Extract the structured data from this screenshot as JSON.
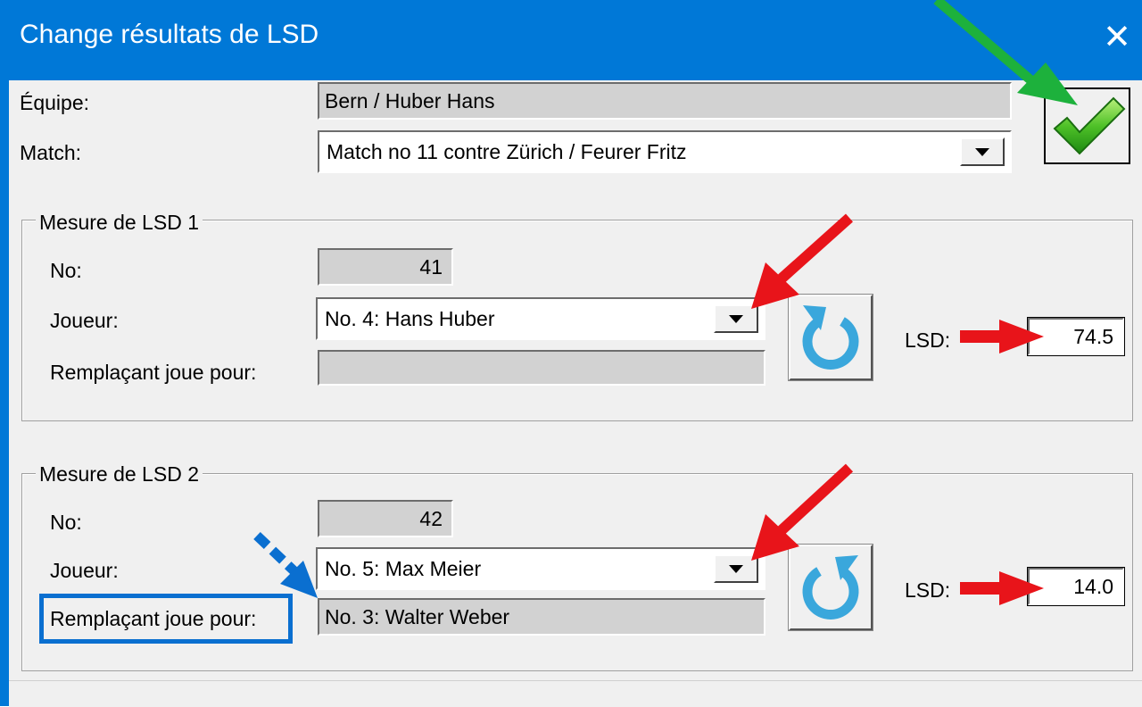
{
  "window": {
    "title": "Change résultats de LSD",
    "close_glyph": "✕"
  },
  "header": {
    "team_label": "Équipe:",
    "team_value": "Bern / Huber Hans",
    "match_label": "Match:",
    "match_value": "Match no 11 contre Zürich / Feurer Fritz",
    "ok_icon": "green-checkmark-icon"
  },
  "groups": [
    {
      "title": "Mesure de LSD 1",
      "no_label": "No:",
      "no_value": "41",
      "player_label": "Joueur:",
      "player_value": "No. 4: Hans Huber",
      "substitute_label": "Remplaçant joue pour:",
      "substitute_value": "",
      "lsd_label": "LSD:",
      "lsd_value": "74.5",
      "refresh_icon": "refresh-clockwise-icon"
    },
    {
      "title": "Mesure de LSD 2",
      "no_label": "No:",
      "no_value": "42",
      "player_label": "Joueur:",
      "player_value": "No. 5: Max Meier",
      "substitute_label": "Remplaçant joue pour:",
      "substitute_value": "No. 3: Walter Weber",
      "lsd_label": "LSD:",
      "lsd_value": "14.0",
      "refresh_icon": "refresh-counterclockwise-icon"
    }
  ],
  "colors": {
    "titlebar": "#0078d7",
    "annotation_red": "#e8141a",
    "annotation_green": "#1db13c",
    "annotation_blue": "#0a6fd0",
    "refresh_icon": "#3aa7dc"
  }
}
